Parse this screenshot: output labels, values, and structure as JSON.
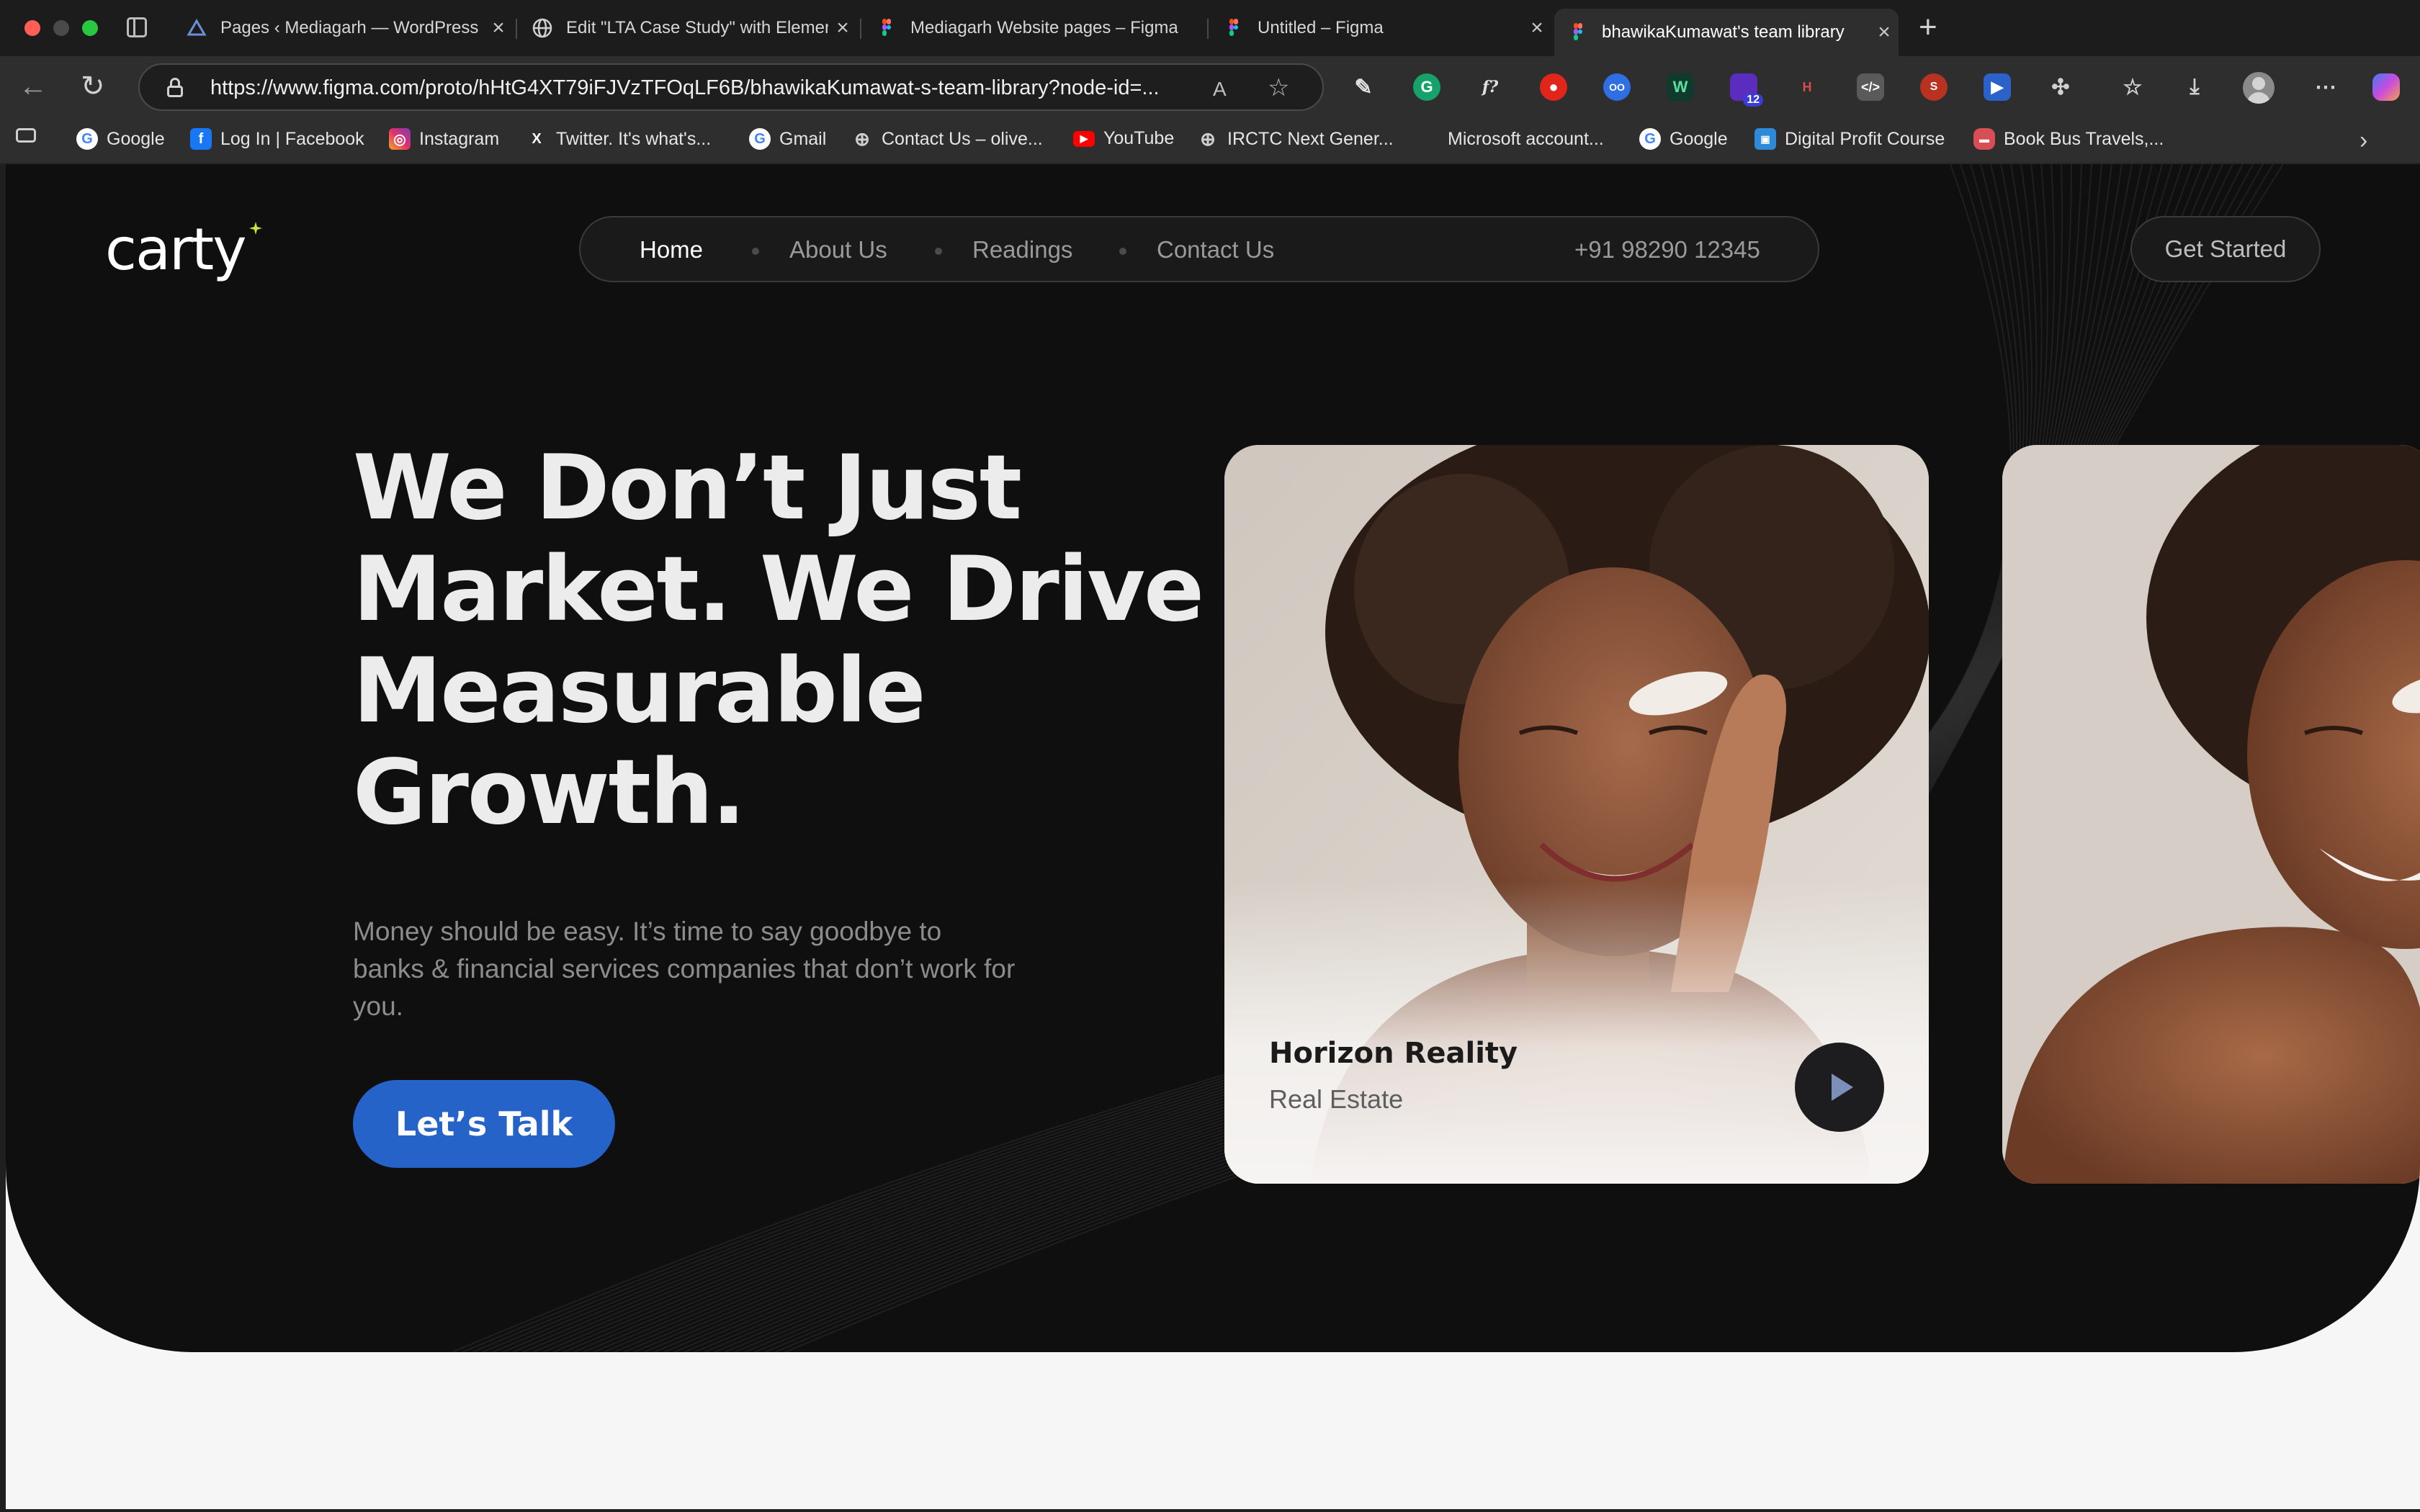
{
  "browser": {
    "tabs": [
      {
        "title": "Pages ‹ Mediagarh — WordPress",
        "icon": "wordpress-icon"
      },
      {
        "title": "Edit \"LTA Case Study\" with Elementor",
        "icon": "globe-icon"
      },
      {
        "title": "Mediagarh Website pages – Figma",
        "icon": "figma-icon"
      },
      {
        "title": "Untitled – Figma",
        "icon": "figma-icon"
      },
      {
        "title": "bhawikaKumawat's team library",
        "icon": "figma-icon",
        "active": true
      }
    ],
    "new_tab_label": "+",
    "url": "https://www.figma.com/proto/hHtG4XT79iFJVzTFOqLF6B/bhawikaKumawat-s-team-library?node-id=...",
    "extension_badge": "12",
    "bookmarks": [
      {
        "label": "Google",
        "icon": "google-icon"
      },
      {
        "label": "Log In | Facebook",
        "icon": "facebook-icon"
      },
      {
        "label": "Instagram",
        "icon": "instagram-icon"
      },
      {
        "label": "Twitter. It's what's...",
        "icon": "x-icon"
      },
      {
        "label": "Gmail",
        "icon": "google-icon"
      },
      {
        "label": "Contact Us – olive...",
        "icon": "globe-icon"
      },
      {
        "label": "YouTube",
        "icon": "youtube-icon"
      },
      {
        "label": "IRCTC Next Gener...",
        "icon": "globe-icon"
      },
      {
        "label": "Microsoft account...",
        "icon": "microsoft-icon"
      },
      {
        "label": "Google",
        "icon": "google-icon"
      },
      {
        "label": "Digital Profit Course",
        "icon": "course-icon"
      },
      {
        "label": "Book Bus Travels,...",
        "icon": "bus-icon"
      }
    ]
  },
  "site": {
    "logo": "carty",
    "nav": [
      {
        "label": "Home",
        "active": true
      },
      {
        "label": "About Us"
      },
      {
        "label": "Readings"
      },
      {
        "label": "Contact Us"
      }
    ],
    "phone": "+91 98290 12345",
    "get_started": "Get Started"
  },
  "hero": {
    "headline_lines": [
      "We Don’t Just",
      "Market. We Drive",
      "Measurable",
      "Growth."
    ],
    "subtext": "Money should be easy. It’s time to say goodbye to banks & financial services companies that don’t work for you.",
    "cta": "Let’s Talk"
  },
  "cards": [
    {
      "title": "Horizon Reality",
      "subtitle": "Real Estate"
    }
  ],
  "colors": {
    "hero_bg": "#0f0f10",
    "page_bg": "#f6f6f6",
    "cta_blue": "#2563c9",
    "logo_accent": "#c6e33a"
  }
}
